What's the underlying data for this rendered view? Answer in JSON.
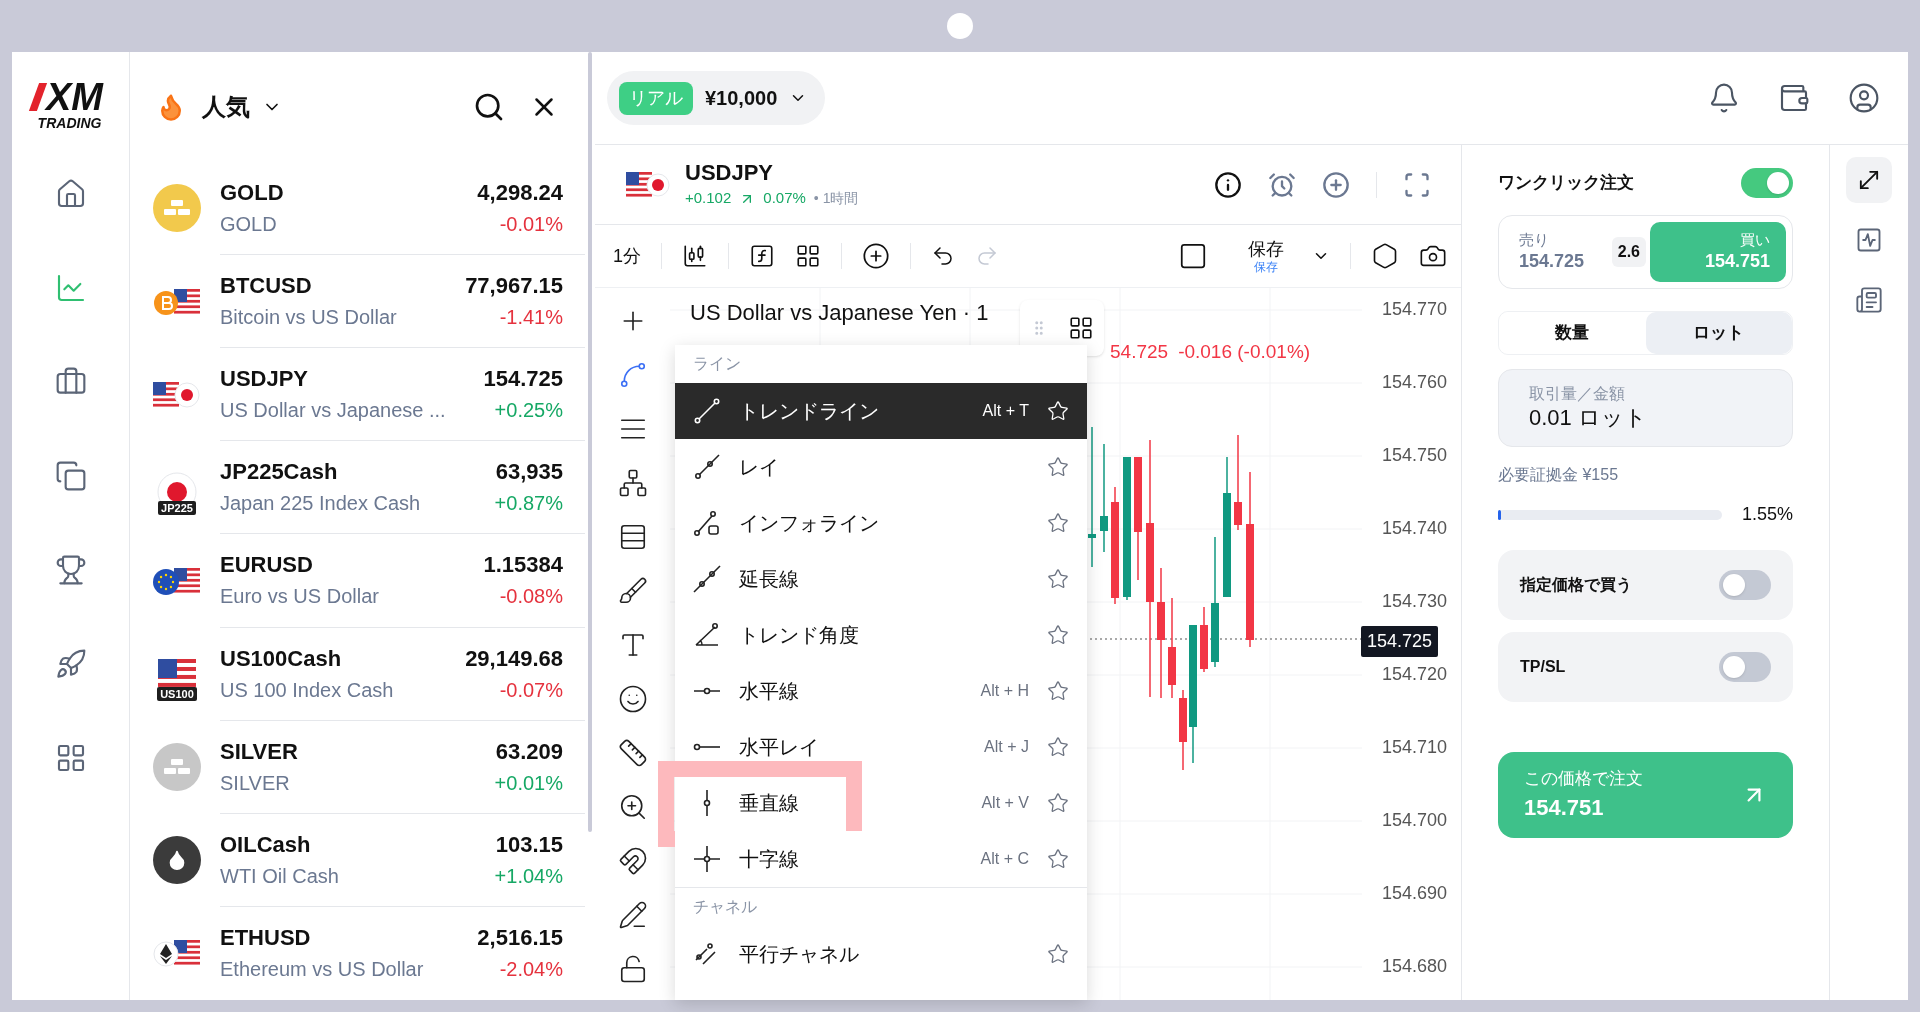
{
  "logo": {
    "text": "XM",
    "subtext": "TRADING"
  },
  "nav": [
    {
      "selected": false
    },
    {
      "selected": true
    },
    {
      "selected": false
    },
    {
      "selected": false
    },
    {
      "selected": false
    },
    {
      "selected": false
    },
    {
      "selected": false
    }
  ],
  "watchlist": {
    "title": "人気",
    "items": [
      {
        "kind": "gold",
        "symbol": "GOLD",
        "name": "GOLD",
        "price": "4,298.24",
        "change": "-0.01%",
        "rising": false
      },
      {
        "kind": "bitcoin",
        "symbol": "BTCUSD",
        "name": "Bitcoin vs US Dollar",
        "price": "77,967.15",
        "change": "-1.41%",
        "rising": false
      },
      {
        "kind": "usdjpy",
        "symbol": "USDJPY",
        "name": "US Dollar vs Japanese ...",
        "price": "154.725",
        "change": "+0.25%",
        "rising": true
      },
      {
        "kind": "index-jp",
        "badge": "JP225",
        "symbol": "JP225Cash",
        "name": "Japan 225 Index Cash",
        "price": "63,935",
        "change": "+0.87%",
        "rising": true
      },
      {
        "kind": "eurusd",
        "symbol": "EURUSD",
        "name": "Euro vs US Dollar",
        "price": "1.15384",
        "change": "-0.08%",
        "rising": false
      },
      {
        "kind": "index-us",
        "badge": "US100",
        "symbol": "US100Cash",
        "name": "US 100 Index Cash",
        "price": "29,149.68",
        "change": "-0.07%",
        "rising": false
      },
      {
        "kind": "silver",
        "symbol": "SILVER",
        "name": "SILVER",
        "price": "63.209",
        "change": "+0.01%",
        "rising": true
      },
      {
        "kind": "oil",
        "symbol": "OILCash",
        "name": "WTI Oil Cash",
        "price": "103.15",
        "change": "+1.04%",
        "rising": true
      },
      {
        "kind": "ether",
        "symbol": "ETHUSD",
        "name": "Ethereum vs US Dollar",
        "price": "2,516.15",
        "change": "-2.04%",
        "rising": false
      }
    ]
  },
  "account": {
    "badge": "リアル",
    "balance": "¥10,000"
  },
  "symbol": {
    "name": "USDJPY",
    "change": "+0.102",
    "percent": "0.07%",
    "timeframe": "• 1時間"
  },
  "toolbar": {
    "interval": "1分",
    "save": "保存",
    "save_sub": "保存",
    "redo_disabled": true
  },
  "tools": [
    {
      "selected": false
    },
    {
      "selected": true
    },
    {
      "selected": false
    },
    {
      "selected": false
    },
    {
      "selected": false
    },
    {
      "selected": false
    },
    {
      "selected": false
    },
    {
      "selected": false
    },
    {
      "selected": false
    },
    {
      "selected": false
    },
    {
      "selected": false
    },
    {
      "selected": false
    },
    {
      "selected": false
    }
  ],
  "chart": {
    "title": "US Dollar vs Japanese Yen · 1",
    "last": "54.725",
    "change": "-0.016 (-0.01%)",
    "prices": [
      "154.770",
      "154.760",
      "154.750",
      "154.740",
      "154.730",
      "154.720",
      "154.710",
      "154.700",
      "154.690",
      "154.680"
    ],
    "current": "154.725"
  },
  "menu": {
    "sections": [
      {
        "title": "ライン",
        "items": [
          {
            "label": "トレンドライン",
            "shortcut": "Alt + T",
            "selected": true,
            "highlighted": false
          },
          {
            "label": "レイ",
            "selected": false,
            "highlighted": false
          },
          {
            "label": "インフォライン",
            "selected": false,
            "highlighted": false
          },
          {
            "label": "延長線",
            "selected": false,
            "highlighted": false
          },
          {
            "label": "トレンド角度",
            "selected": false,
            "highlighted": false
          },
          {
            "label": "水平線",
            "shortcut": "Alt + H",
            "selected": false,
            "highlighted": false
          },
          {
            "label": "水平レイ",
            "shortcut": "Alt + J",
            "selected": false,
            "highlighted": false
          },
          {
            "label": "垂直線",
            "shortcut": "Alt + V",
            "selected": false,
            "highlighted": true
          },
          {
            "label": "十字線",
            "shortcut": "Alt + C",
            "selected": false,
            "highlighted": false
          }
        ]
      },
      {
        "title": "チャネル",
        "items": [
          {
            "label": "平行チャネル",
            "selected": false,
            "highlighted": false
          }
        ]
      }
    ]
  },
  "order": {
    "one_click": {
      "label": "ワンクリック注文",
      "on": true
    },
    "sell": {
      "label": "売り",
      "price": "154.725"
    },
    "spread": "2.6",
    "buy": {
      "label": "買い",
      "price": "154.751"
    },
    "units": [
      {
        "label": "数量",
        "selected": false
      },
      {
        "label": "ロット",
        "selected": true
      }
    ],
    "volume": {
      "label": "取引量／金額",
      "value": "0.01 ロット"
    },
    "margin": "必要証拠金 ¥155",
    "usage": {
      "level": 0.0155,
      "reading": "1.55%"
    },
    "toggles": [
      {
        "label": "指定価格で買う",
        "on": false
      },
      {
        "label": "TP/SL",
        "on": false
      }
    ],
    "submit": {
      "label": "この価格で注文",
      "price": "154.751"
    }
  },
  "side_tools": [
    {
      "selected": true
    },
    {
      "selected": false
    },
    {
      "selected": false
    }
  ]
}
